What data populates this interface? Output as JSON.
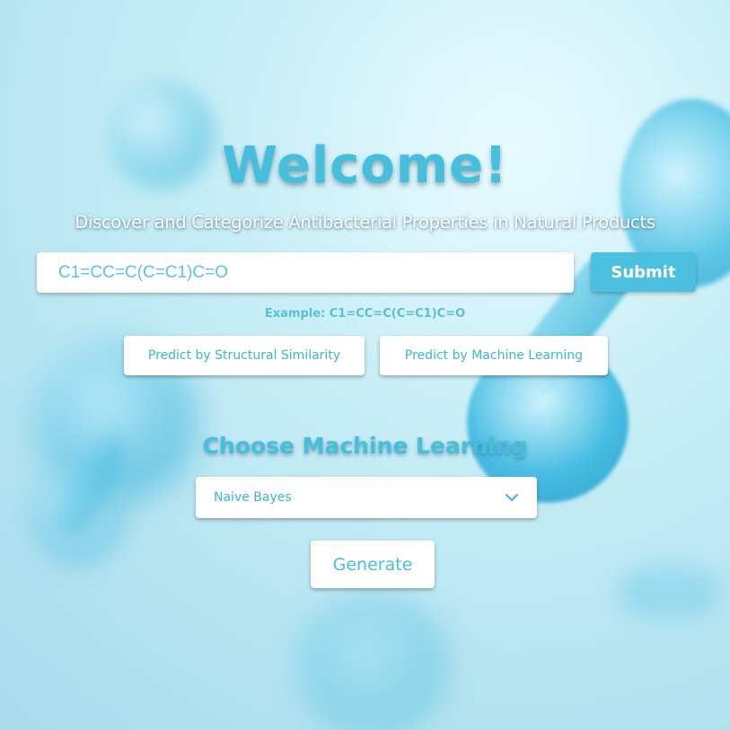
{
  "header": {
    "title": "Welcome!",
    "subtitle": "Discover and Categorize Antibacterial Properties in Natural Products"
  },
  "search": {
    "value": "C1=CC=C(C=C1)C=O",
    "placeholder": "C1=CC=C(C=C1)C=O",
    "submit_label": "Submit",
    "example_text": "Example: C1=CC=C(C=C1)C=O"
  },
  "modes": {
    "structural_label": "Predict by Structural Similarity",
    "ml_label": "Predict by Machine Learning"
  },
  "ml_section": {
    "title": "Choose Machine Learning",
    "selected_model": "Naive Bayes",
    "chevron_icon": "chevron-down-icon",
    "generate_label": "Generate"
  },
  "theme": {
    "accent": "#45bfdb",
    "button_fill": "#4cc1df",
    "text_light": "#ffffff"
  }
}
